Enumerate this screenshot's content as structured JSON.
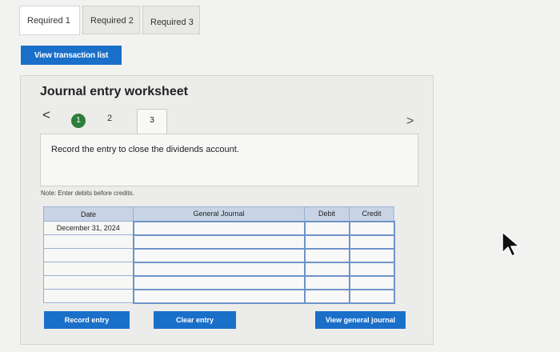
{
  "tabs": [
    {
      "label": "Required 1",
      "active": true
    },
    {
      "label": "Required 2",
      "active": false
    },
    {
      "label": "Required 3",
      "active": false
    }
  ],
  "view_transaction_list": "View transaction list",
  "worksheet": {
    "title": "Journal entry worksheet",
    "nav": {
      "prev": "<",
      "next": ">"
    },
    "steps": [
      "1",
      "2",
      "3"
    ],
    "current_step": "3",
    "instruction": "Record the entry to close the dividends account.",
    "note": "Note: Enter debits before credits.",
    "table": {
      "headers": [
        "Date",
        "General Journal",
        "Debit",
        "Credit"
      ],
      "rows": [
        [
          "December 31, 2024",
          "",
          "",
          ""
        ],
        [
          "",
          "",
          "",
          ""
        ],
        [
          "",
          "",
          "",
          ""
        ],
        [
          "",
          "",
          "",
          ""
        ],
        [
          "",
          "",
          "",
          ""
        ],
        [
          "",
          "",
          "",
          ""
        ]
      ]
    },
    "buttons": {
      "record": "Record entry",
      "clear": "Clear entry",
      "view_general_journal": "View general journal"
    }
  },
  "colors": {
    "primary_button": "#1a6fc9",
    "header_fill": "#c8d4e6",
    "step_complete": "#2e7d3c"
  },
  "icons": {
    "cursor": "mouse-pointer-icon"
  }
}
